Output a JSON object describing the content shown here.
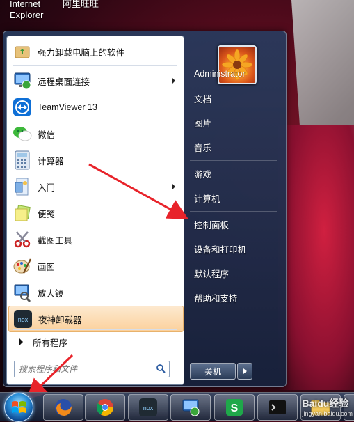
{
  "desktop": {
    "icons": [
      {
        "label_line1": "Internet",
        "label_line2": "Explorer"
      },
      {
        "label_line1": "阿里旺旺"
      }
    ]
  },
  "start_menu": {
    "programs": [
      {
        "label": "强力卸载电脑上的软件",
        "icon": "uninstall-box-icon",
        "submenu": false
      },
      {
        "label": "远程桌面连接",
        "icon": "remote-desktop-icon",
        "submenu": true
      },
      {
        "label": "TeamViewer 13",
        "icon": "teamviewer-icon",
        "submenu": false
      },
      {
        "label": "微信",
        "icon": "wechat-icon",
        "submenu": false
      },
      {
        "label": "计算器",
        "icon": "calculator-icon",
        "submenu": false
      },
      {
        "label": "入门",
        "icon": "getting-started-icon",
        "submenu": true
      },
      {
        "label": "便笺",
        "icon": "sticky-notes-icon",
        "submenu": false
      },
      {
        "label": "截图工具",
        "icon": "snipping-tool-icon",
        "submenu": false
      },
      {
        "label": "画图",
        "icon": "paint-icon",
        "submenu": false
      },
      {
        "label": "放大镜",
        "icon": "magnifier-icon",
        "submenu": false
      },
      {
        "label": "夜神卸载器",
        "icon": "nox-icon",
        "submenu": false,
        "highlighted": true
      }
    ],
    "all_programs": "所有程序",
    "search_placeholder": "搜索程序和文件",
    "right": {
      "user": "Administrator",
      "items": [
        "文档",
        "图片",
        "音乐",
        "游戏",
        "计算机",
        "控制面板",
        "设备和打印机",
        "默认程序",
        "帮助和支持"
      ]
    },
    "shutdown_label": "关机"
  },
  "taskbar": {
    "apps": [
      "firefox-icon",
      "chrome-icon",
      "nox-icon",
      "remote-desktop-icon",
      "swyx-icon",
      "terminal-icon",
      "file-explorer-icon"
    ],
    "colors": {
      "accent": "#2a8fd8",
      "highlight": "#fbd09b"
    }
  },
  "watermark": "Baidu经验",
  "watermark_sub": "jingyan.baidu.com"
}
